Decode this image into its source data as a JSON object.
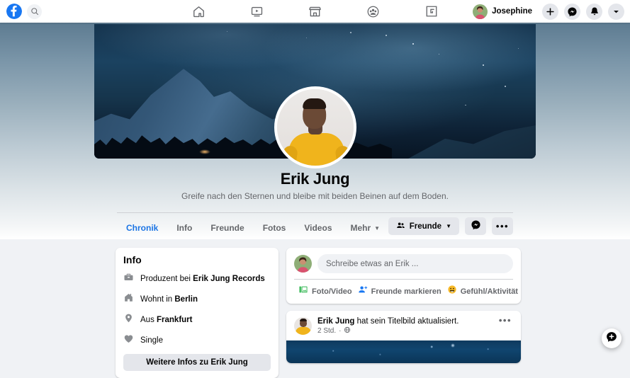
{
  "topnav": {
    "logo_icon": "facebook-logo-icon",
    "search_icon": "search-icon",
    "tabs": [
      {
        "name": "home",
        "icon": "home-icon"
      },
      {
        "name": "watch",
        "icon": "video-screen-icon"
      },
      {
        "name": "marketplace",
        "icon": "storefront-icon"
      },
      {
        "name": "groups",
        "icon": "groups-people-icon"
      },
      {
        "name": "gaming",
        "icon": "gaming-controller-icon"
      }
    ],
    "user": {
      "name": "Josephine",
      "avatar_icon": "user-avatar"
    },
    "actions": [
      {
        "name": "create",
        "icon": "plus-icon"
      },
      {
        "name": "messenger",
        "icon": "messenger-icon"
      },
      {
        "name": "notifications",
        "icon": "bell-icon"
      },
      {
        "name": "account-menu",
        "icon": "chevron-down-icon"
      }
    ]
  },
  "profile": {
    "name": "Erik Jung",
    "bio": "Greife nach den Sternen und bleibe mit beiden Beinen auf dem Boden.",
    "cover_icon": "cover-photo-night-mountains",
    "avatar_icon": "profile-avatar-erik-jung"
  },
  "tabs": [
    {
      "label": "Chronik",
      "active": true,
      "caret": false
    },
    {
      "label": "Info",
      "active": false,
      "caret": false
    },
    {
      "label": "Freunde",
      "active": false,
      "caret": false
    },
    {
      "label": "Fotos",
      "active": false,
      "caret": false
    },
    {
      "label": "Videos",
      "active": false,
      "caret": false
    },
    {
      "label": "Mehr",
      "active": false,
      "caret": true
    }
  ],
  "profile_actions": {
    "friends_label": "Freunde",
    "friends_icon": "friends-people-icon",
    "friends_caret": "▾",
    "message_icon": "messenger-icon",
    "more_label": "•••"
  },
  "info_card": {
    "title": "Info",
    "rows": [
      {
        "icon": "briefcase-icon",
        "prefix": "Produzent bei ",
        "bold": "Erik Jung Records"
      },
      {
        "icon": "house-icon",
        "prefix": "Wohnt in ",
        "bold": "Berlin"
      },
      {
        "icon": "location-pin-icon",
        "prefix": "Aus ",
        "bold": "Frankfurt"
      },
      {
        "icon": "heart-icon",
        "prefix": "Single",
        "bold": ""
      }
    ],
    "button_label": "Weitere Infos zu Erik Jung"
  },
  "composer": {
    "avatar_icon": "user-avatar",
    "placeholder": "Schreibe etwas an Erik ...",
    "actions": [
      {
        "icon": "photo-video-icon",
        "label": "Foto/Video"
      },
      {
        "icon": "tag-friends-icon",
        "label": "Freunde markieren"
      },
      {
        "icon": "feeling-activity-icon",
        "label": "Gefühl/Aktivität"
      }
    ]
  },
  "post": {
    "author": "Erik Jung",
    "action_text": " hat sein Titelbild aktualisiert.",
    "time": "2 Std.",
    "separator": "·",
    "privacy_icon": "globe-icon",
    "menu_label": "•••",
    "image_icon": "post-image-starry-blue"
  },
  "fab": {
    "icon": "new-message-bubble-icon"
  },
  "colors": {
    "brand_blue": "#1877f2",
    "active_tab_blue": "#1b74e4",
    "page_bg": "#f0f2f5",
    "card_bg": "#ffffff",
    "grey_button": "#e4e6eb",
    "secondary_text": "#65676b",
    "primary_text": "#050505"
  }
}
